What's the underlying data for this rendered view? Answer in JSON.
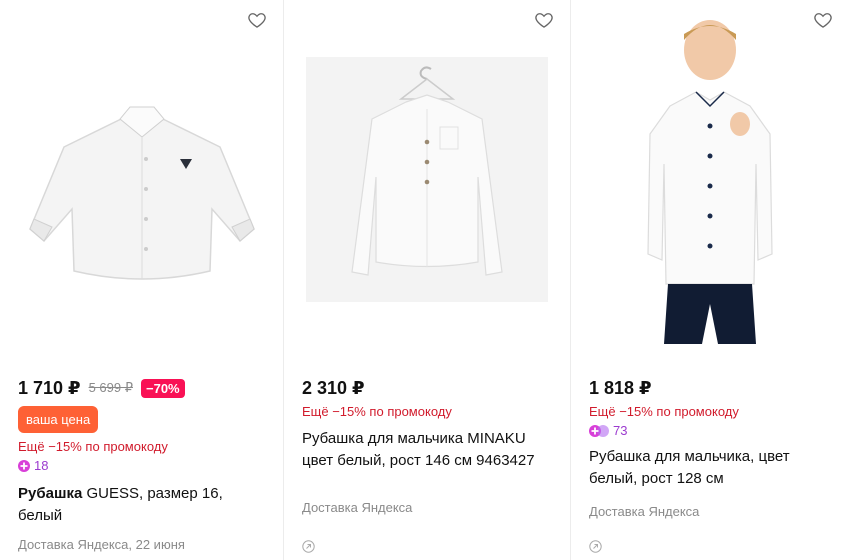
{
  "products": [
    {
      "price": "1 710 ₽",
      "old_price": "5 699 ₽",
      "discount": "−70%",
      "your_price_label": "ваша цена",
      "promo": "Ещё −15% по промокоду",
      "plus_points": "18",
      "title_brand": "Рубашка",
      "title_rest": " GUESS, размер 16, белый",
      "delivery": "Доставка Яндекса, 22 июня"
    },
    {
      "price": "2 310 ₽",
      "promo": "Ещё −15% по промокоду",
      "title": "Рубашка для мальчика MINAKU цвет белый, рост 146 см 9463427",
      "delivery": "Доставка Яндекса"
    },
    {
      "price": "1 818 ₽",
      "promo": "Ещё −15% по промокоду",
      "plus_points": "73",
      "title": "Рубашка для мальчика, цвет белый, рост 128 см",
      "delivery": "Доставка Яндекса"
    }
  ],
  "icons": {
    "favorite": "heart-outline-icon",
    "plus": "yandex-plus-icon",
    "external": "external-arrow-icon"
  },
  "colors": {
    "discount": "#f91155",
    "your_price": "#fe6135",
    "promo": "#d11b2c",
    "plus": "#9c3bcf"
  }
}
